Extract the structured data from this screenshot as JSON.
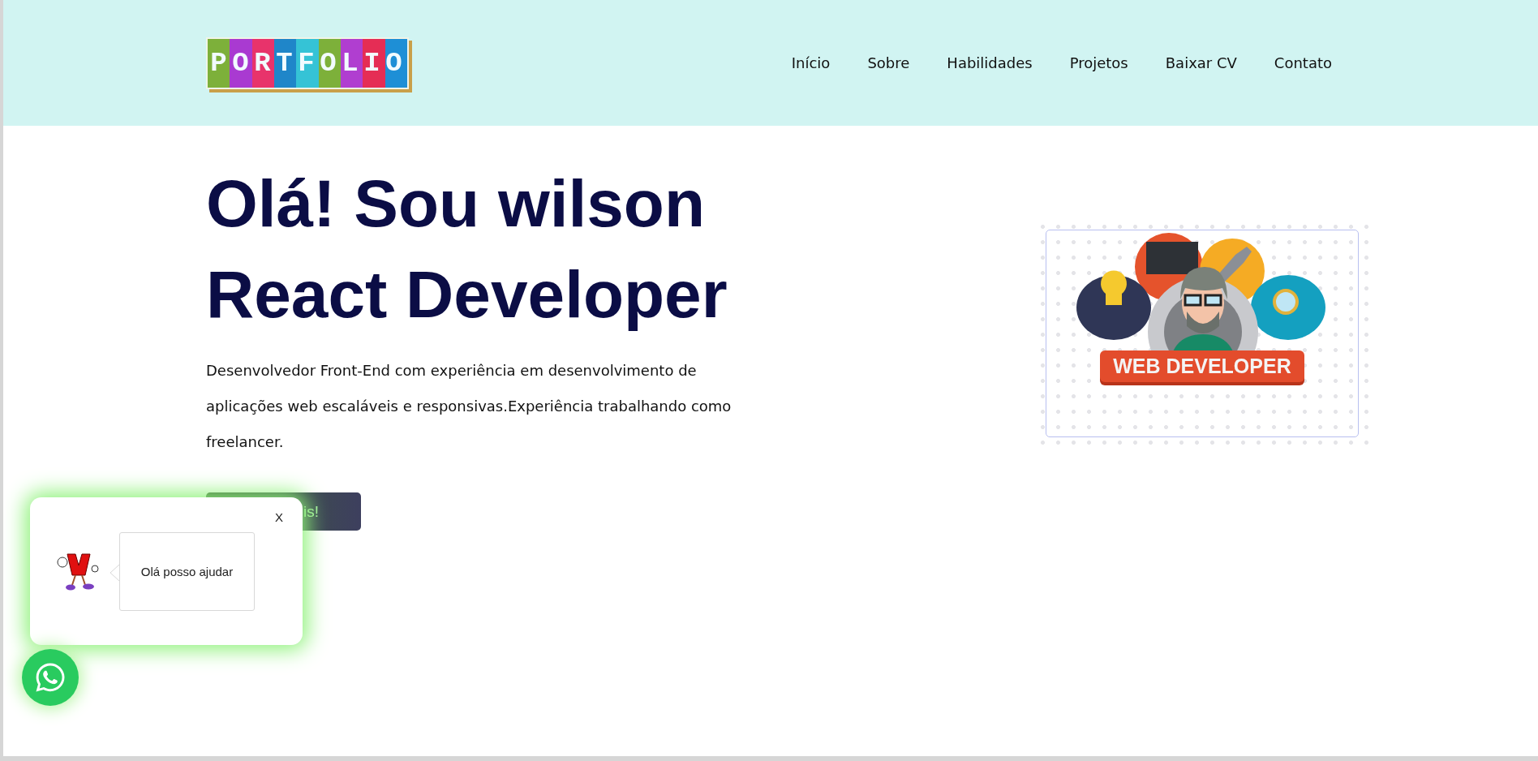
{
  "header": {
    "logo": "PORTFOLIO",
    "nav": [
      {
        "label": "Início"
      },
      {
        "label": "Sobre"
      },
      {
        "label": "Habilidades"
      },
      {
        "label": "Projetos"
      },
      {
        "label": "Baixar CV"
      },
      {
        "label": "Contato"
      }
    ]
  },
  "hero": {
    "heading_lines": [
      "Olá! Sou wilson",
      "React Developer"
    ],
    "description": "Desenvolvedor Front-End com experiência em desenvolvimento de aplicações web escaláveis e responsivas.Experiência trabalhando como freelancer.",
    "button": "is!",
    "illustration_banner": "WEB DEVELOPER"
  },
  "chat_popup": {
    "close": "X",
    "message": "Olá posso ajudar"
  }
}
